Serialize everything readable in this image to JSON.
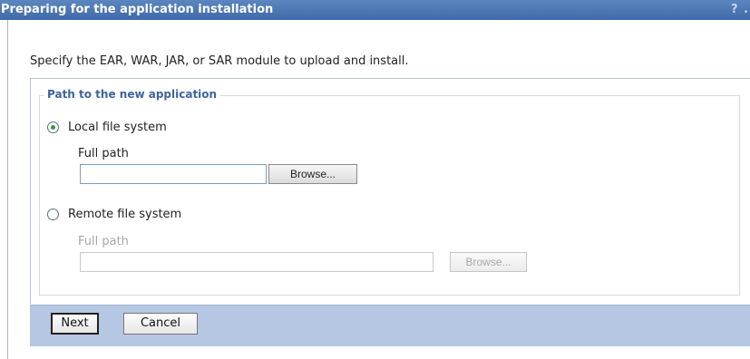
{
  "window": {
    "title": "Preparing for the application installation",
    "help_glyph": "?",
    "edge_glyph": "."
  },
  "instruction": "Specify the EAR, WAR, JAR, or SAR module to upload and install.",
  "path_group": {
    "legend": "Path to the new application",
    "local": {
      "label": "Local file system",
      "selected": true,
      "full_path_label": "Full path",
      "value": "",
      "browse_label": "Browse..."
    },
    "remote": {
      "label": "Remote file system",
      "selected": false,
      "full_path_label": "Full path",
      "value": "",
      "browse_label": "Browse..."
    }
  },
  "buttons": {
    "next": "Next",
    "cancel": "Cancel"
  },
  "colors": {
    "title_bar": "#4a76b2",
    "legend_text": "#3d63a0",
    "button_bar": "#b5c7e2",
    "selected_radio_dot": "#2e9c3a"
  }
}
